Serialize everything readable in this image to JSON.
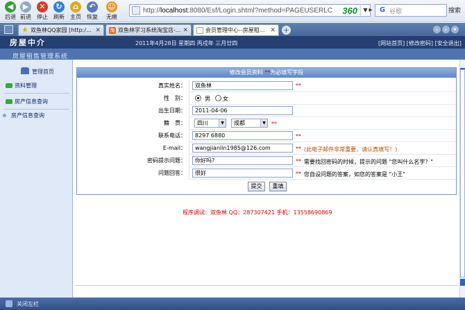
{
  "browser": {
    "nav_buttons": [
      {
        "label": "后退",
        "icon": "back-arrow-icon",
        "color": "#3a9a3a"
      },
      {
        "label": "前进",
        "icon": "forward-arrow-icon",
        "color": "#8fa8c8"
      },
      {
        "label": "停止",
        "icon": "stop-icon",
        "color": "#d53b2a"
      },
      {
        "label": "刷新",
        "icon": "refresh-icon",
        "color": "#2f7fd6"
      },
      {
        "label": "主页",
        "icon": "home-icon",
        "color": "#e0a91c"
      },
      {
        "label": "恢复",
        "icon": "restore-icon",
        "color": "#5a78b8"
      },
      {
        "label": "无痕",
        "icon": "incognito-icon",
        "color": "#e79a27"
      }
    ],
    "address_prefix": "http://",
    "address_host": "localhost",
    "address_rest": ":8080/Esf/Login.shtml?method=PAGEUSERLC",
    "brand": "360",
    "search_placeholder": "谷歌",
    "search_go": "搜索",
    "tabs": [
      {
        "title": "双鱼林QQ家园 [http:/...",
        "icon": "star-icon",
        "active": false
      },
      {
        "title": "双鱼林学习系统淘宝店-...",
        "icon": "taobao-icon",
        "active": false
      },
      {
        "title": "会员管理中心--房屋租...",
        "icon": "page-icon",
        "active": true
      }
    ]
  },
  "header": {
    "logo": "房屋中介",
    "date_line": "2011年4月28日 星期四 丙戌年 三月廿四",
    "links": "[网站首页] [修改密码] [安全退出]",
    "subtitle": "房屋租售管理系统"
  },
  "sidebar": {
    "head": "管理首页",
    "items": [
      "资料管理",
      "房产信息查询",
      "房产信息查询"
    ]
  },
  "form": {
    "header_text": "修改会员资料",
    "header_req": "**",
    "header_suffix": "为必填写字段",
    "fields": {
      "name_label": "真实姓名：",
      "name_value": "双鱼林",
      "gender_label": "性　别：",
      "gender_male": "男",
      "gender_female": "女",
      "birth_label": "出生日期：",
      "birth_value": "2011-04-06",
      "native_label": "籍　贯：",
      "province": "四川",
      "city": "成都",
      "phone_label": "联系电话：",
      "phone_value": "8297 6880",
      "email_label": "E-mail：",
      "email_value": "wangjianlin1985@126.com",
      "email_hint": "(此电子邮件非常重要，请认真填写！)",
      "question_label": "密码提示问题：",
      "question_value": "你好吗?",
      "question_hint": "需要找回密码的时候，提示的问题 \"您叫什么名字？\"",
      "answer_label": "问题回答：",
      "answer_value": "很好",
      "answer_hint": "您自设问题的答案，如您的答案是 \"小王\""
    },
    "required_mark": "**",
    "submit_label": "提交",
    "reset_label": "重填"
  },
  "footer": {
    "note": "程序调试：双鱼林 QQ：287307421 手机：13558690869"
  },
  "statusbar": {
    "text": "关闭左栏"
  }
}
